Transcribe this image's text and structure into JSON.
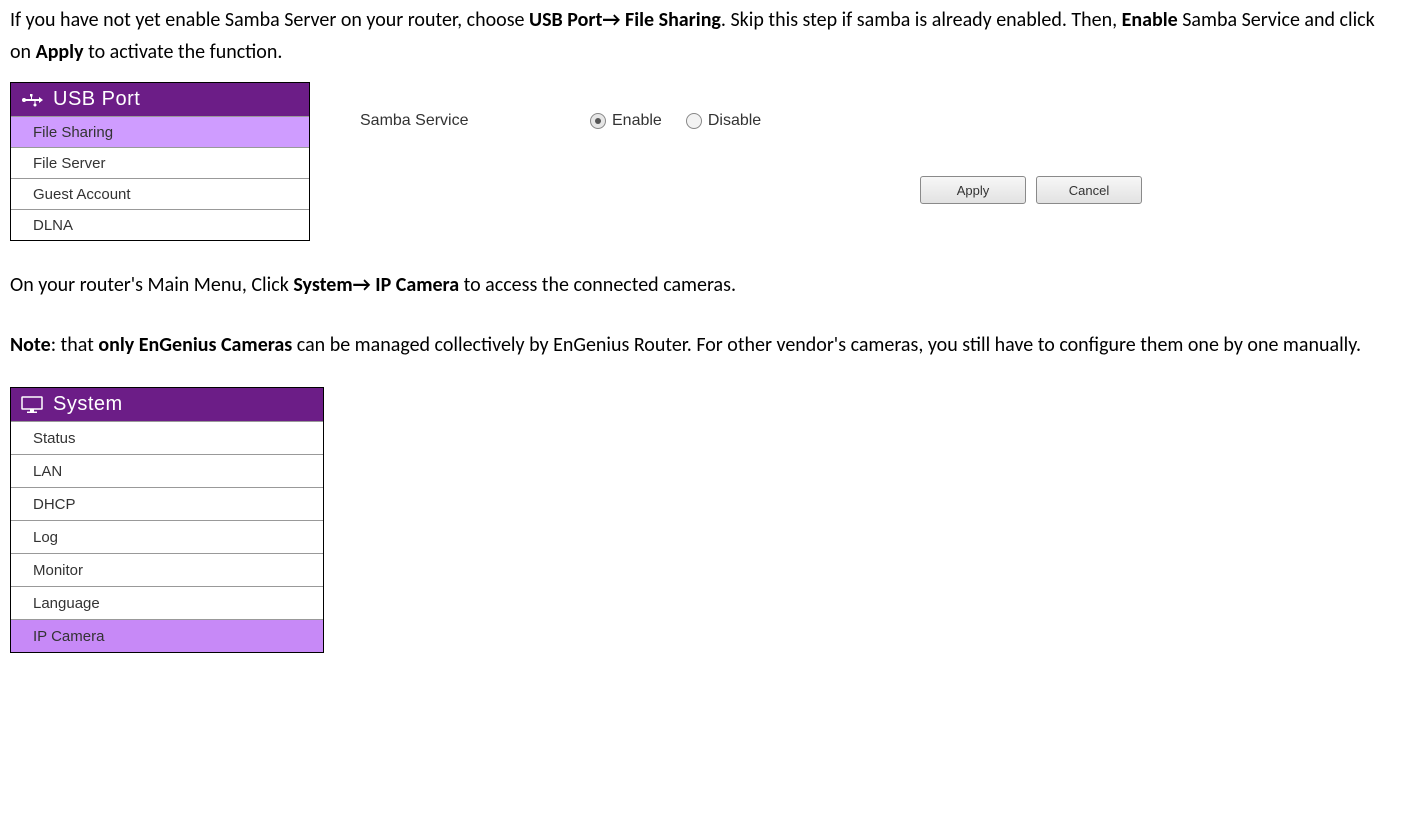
{
  "intro": {
    "part1": "If you have not yet enable Samba Server on your router, choose ",
    "bold1_a": "USB Port",
    "arrow": "→",
    "bold1_b": " File Sharing",
    "part2": ". Skip this step if samba is already enabled. Then, ",
    "bold2": "Enable",
    "part3": " Samba Service and click on ",
    "bold3": "Apply",
    "part4": " to activate the function."
  },
  "usb_menu": {
    "title": "USB Port",
    "items": [
      "File Sharing",
      "File Server",
      "Guest Account",
      "DLNA"
    ],
    "selected_index": 0
  },
  "samba": {
    "label": "Samba Service",
    "option_enable": "Enable",
    "option_disable": "Disable",
    "selected": "enable",
    "apply": "Apply",
    "cancel": "Cancel"
  },
  "paragraph2": {
    "part1": "On your router's Main Menu, Click ",
    "bold_a": "System",
    "arrow": "→",
    "bold_b": " IP Camera",
    "part2": " to access the connected cameras."
  },
  "note": {
    "lead": "Note",
    "colon": ": that ",
    "bold": "only EnGenius Cameras",
    "rest": " can be managed collectively by EnGenius Router. For other vendor's cameras, you still have to configure them one by one manually."
  },
  "system_menu": {
    "title": "System",
    "items": [
      "Status",
      "LAN",
      "DHCP",
      "Log",
      "Monitor",
      "Language",
      "IP Camera"
    ],
    "selected_index": 6
  }
}
